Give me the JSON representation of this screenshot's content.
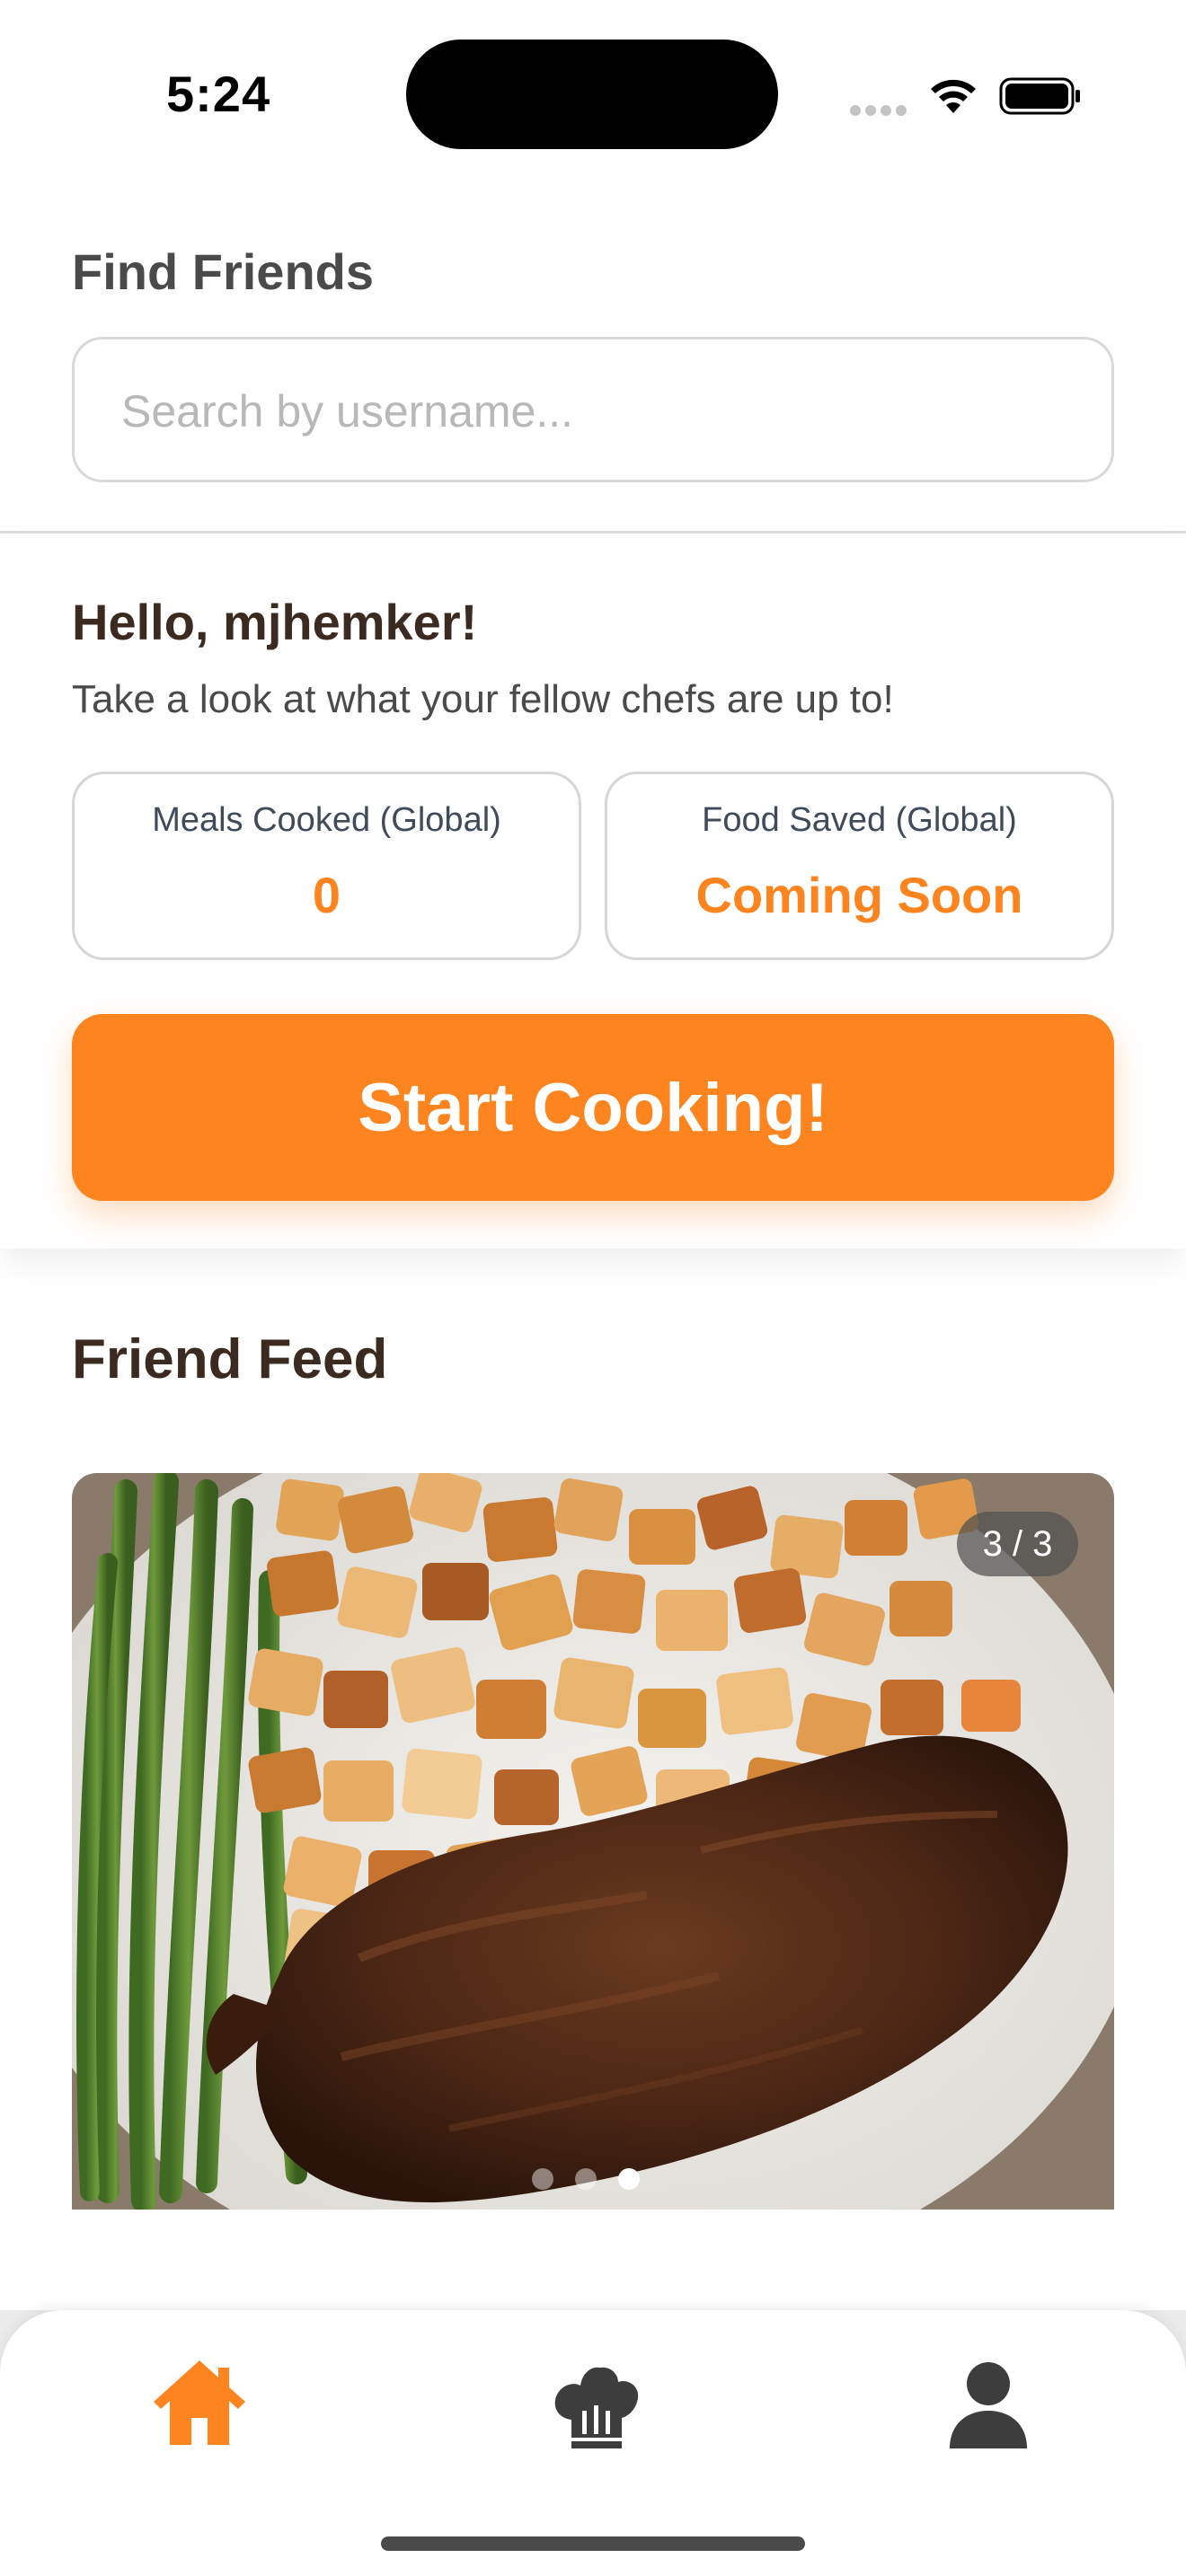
{
  "status_bar": {
    "time": "5:24"
  },
  "find_friends": {
    "title": "Find Friends",
    "search_placeholder": "Search by username..."
  },
  "hello": {
    "greeting": "Hello, mjhemker!",
    "subtitle": "Take a look at what your fellow chefs are up to!",
    "stats": [
      {
        "label": "Meals Cooked (Global)",
        "value": "0"
      },
      {
        "label": "Food Saved (Global)",
        "value": "Coming Soon"
      }
    ],
    "start_button": "Start Cooking!"
  },
  "feed": {
    "title": "Friend Feed",
    "counter": "3 / 3",
    "current_index": 3,
    "total": 3
  },
  "tabs": [
    {
      "name": "home",
      "icon": "home-icon",
      "active": true
    },
    {
      "name": "cook",
      "icon": "chef-hat-icon",
      "active": false
    },
    {
      "name": "profile",
      "icon": "person-icon",
      "active": false
    }
  ],
  "colors": {
    "accent": "#fd841f",
    "heading": "#3a2a20",
    "inactive_icon": "#3d3d3d"
  }
}
